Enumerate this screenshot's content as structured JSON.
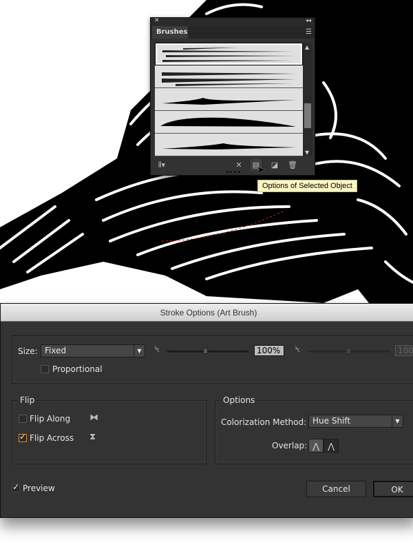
{
  "brushes_panel": {
    "close_icon": "close-icon",
    "collapse_icon": "double-chevron-icon",
    "tab": "Brushes",
    "menu_icon": "panel-menu-icon",
    "brush_rows": 5,
    "selected_row": 1,
    "toolbar": [
      "brush-libraries-icon",
      "remove-stroke-icon",
      "options-icon",
      "new-brush-icon",
      "delete-icon"
    ]
  },
  "tooltip": "Options of Selected Object",
  "dialog": {
    "title": "Stroke Options (Art Brush)",
    "size_label": "Size:",
    "size_value": "Fixed",
    "size_percent": "100%",
    "size_percent_disabled": "100%",
    "slider_value_percent": 100,
    "proportional_label": "Proportional",
    "proportional_checked": false,
    "flip": {
      "legend": "Flip",
      "along_label": "Flip Along",
      "along_checked": false,
      "across_label": "Flip Across",
      "across_checked": true
    },
    "options": {
      "legend": "Options",
      "colorization_label": "Colorization Method:",
      "colorization_value": "Hue Shift",
      "overlap_label": "Overlap:"
    },
    "preview_label": "Preview",
    "preview_checked": true,
    "cancel": "Cancel",
    "ok": "OK"
  },
  "colors": {
    "dialog_bg": "#333333",
    "focus": "#e58a28",
    "tooltip_bg": "#fbf5c4"
  }
}
